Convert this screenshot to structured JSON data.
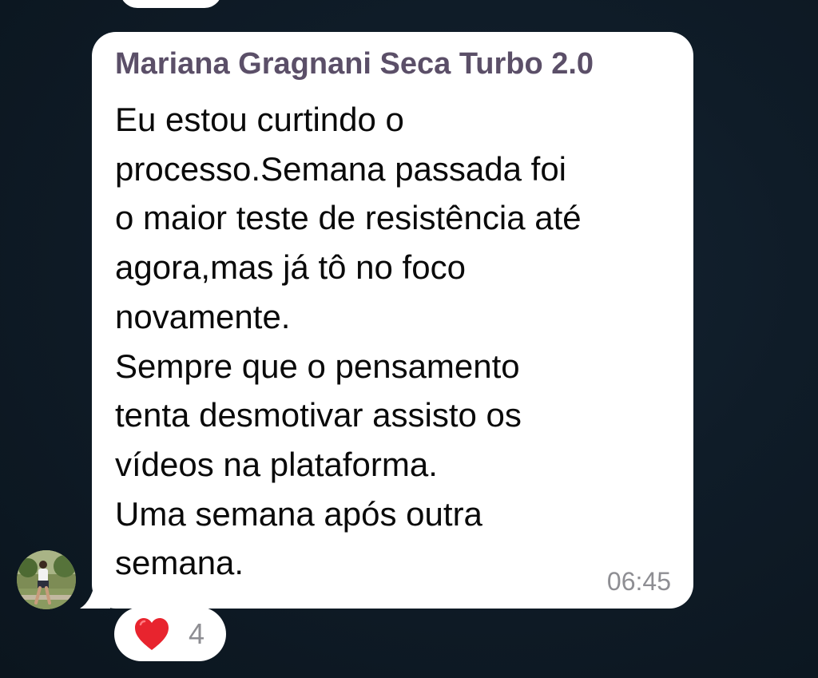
{
  "message": {
    "sender": "Mariana Gragnani Seca Turbo 2.0",
    "text": "Eu estou curtindo o\nprocesso.Semana passada foi\no maior teste de resistência até\nagora,mas já tô no foco\nnovamente.\nSempre que o pensamento\ntenta desmotivar assisto os\nvídeos na plataforma.\nUma semana após outra\nsemana.",
    "time": "06:45"
  },
  "reaction": {
    "icon": "heart-icon",
    "count": "4"
  },
  "colors": {
    "sender_name": "#5b4f68",
    "bubble": "#ffffff",
    "heart": "#e8242e"
  }
}
